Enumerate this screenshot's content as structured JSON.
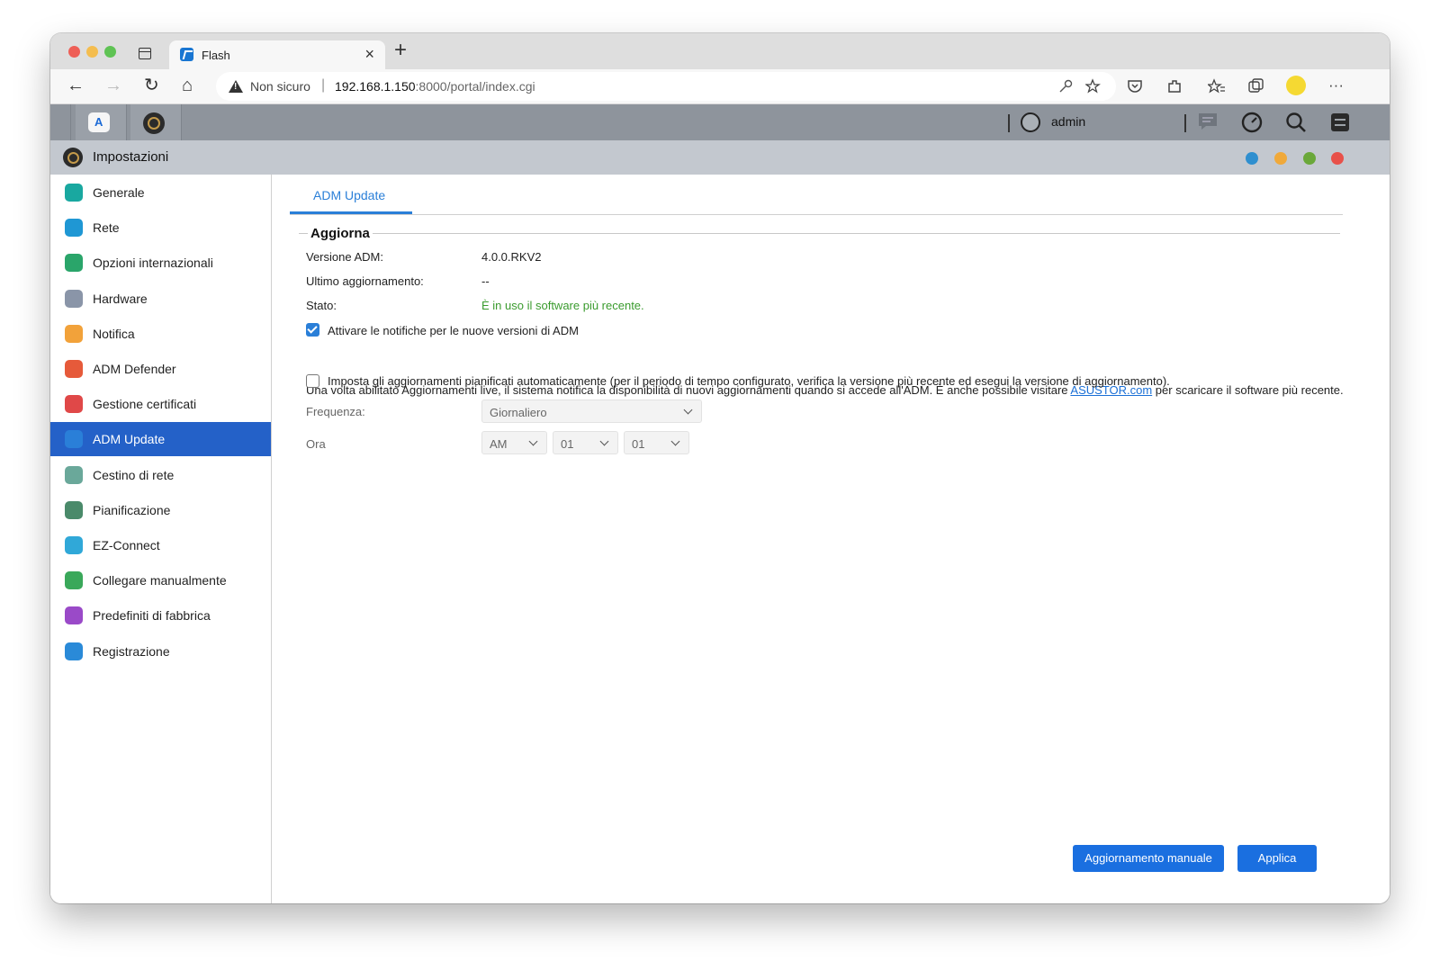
{
  "browser": {
    "tab_title": "Flash",
    "tab_close": "×",
    "new_tab": "+",
    "address": {
      "security_label": "Non sicuro",
      "separator": "|",
      "host": "192.168.1.150",
      "path": ":8000/portal/index.cgi"
    },
    "nav": {
      "back": "←",
      "forward": "→",
      "reload": "↻",
      "home": "⌂"
    },
    "toolbar_icons": [
      "key-icon",
      "favorite-add-icon",
      "pocket-icon",
      "extensions-icon",
      "favorites-icon",
      "collections-icon",
      "profile-icon",
      "more-icon"
    ],
    "more_glyph": "···"
  },
  "adm": {
    "user": "admin",
    "app_icons": [
      "asus-app-icon",
      "settings-app-icon"
    ],
    "bar_icons": [
      "messages-icon",
      "dashboard-icon",
      "search-icon",
      "control-icon"
    ]
  },
  "settings_window": {
    "title": "Impostazioni",
    "dot_colors": [
      "#2f8fcf",
      "#f0a93a",
      "#6aa83a",
      "#e8514a"
    ]
  },
  "sidebar": {
    "items": [
      {
        "label": "Generale",
        "icon": "general-icon",
        "color": "#19a8a0"
      },
      {
        "label": "Rete",
        "icon": "globe-icon",
        "color": "#1f97d4"
      },
      {
        "label": "Opzioni internazionali",
        "icon": "international-icon",
        "color": "#2aa56a"
      },
      {
        "label": "Hardware",
        "icon": "hardware-icon",
        "color": "#8a95a8"
      },
      {
        "label": "Notifica",
        "icon": "notification-icon",
        "color": "#f2a23a"
      },
      {
        "label": "ADM Defender",
        "icon": "defender-icon",
        "color": "#e65a3a"
      },
      {
        "label": "Gestione certificati",
        "icon": "certificate-icon",
        "color": "#e04848"
      },
      {
        "label": "ADM Update",
        "icon": "update-icon",
        "color": "#2a7fd8",
        "active": true
      },
      {
        "label": "Cestino di rete",
        "icon": "recycle-bin-icon",
        "color": "#6aa89a"
      },
      {
        "label": "Pianificazione",
        "icon": "schedule-icon",
        "color": "#4a8a6a"
      },
      {
        "label": "EZ-Connect",
        "icon": "cloud-icon",
        "color": "#30a8d8"
      },
      {
        "label": "Collegare manualmente",
        "icon": "manual-connect-icon",
        "color": "#3aa85a"
      },
      {
        "label": "Predefiniti di fabbrica",
        "icon": "factory-reset-icon",
        "color": "#9a4ac8"
      },
      {
        "label": "Registrazione",
        "icon": "registration-icon",
        "color": "#2a8ad8"
      }
    ]
  },
  "main": {
    "tab": "ADM Update",
    "section_title": "Aggiorna",
    "version_label": "Versione ADM:",
    "version_value": "4.0.0.RKV2",
    "last_update_label": "Ultimo aggiornamento:",
    "last_update_value": "--",
    "status_label": "Stato:",
    "status_value": "È in uso il software più recente.",
    "notify_checkbox": {
      "label": "Attivare le notifiche per le nuove versioni di ADM",
      "checked": true
    },
    "description": {
      "before": "Una volta abilitato Aggiornamenti live, il sistema notifica la disponibilità di nuovi aggiornamenti quando si accede all'ADM. È anche possibile visitare ",
      "link": "ASUSTOR.com",
      "after": " per scaricare il software più recente."
    },
    "auto_checkbox": {
      "label": "Imposta gli aggiornamenti pianificati automaticamente (per il periodo di tempo configurato, verifica la versione più recente ed esegui la versione di aggiornamento).",
      "checked": false
    },
    "frequency_label": "Frequenza:",
    "frequency_value": "Giornaliero",
    "time_label": "Ora",
    "ampm_value": "AM",
    "hour_value": "01",
    "minute_value": "01",
    "manual_button": "Aggiornamento manuale",
    "apply_button": "Applica"
  }
}
